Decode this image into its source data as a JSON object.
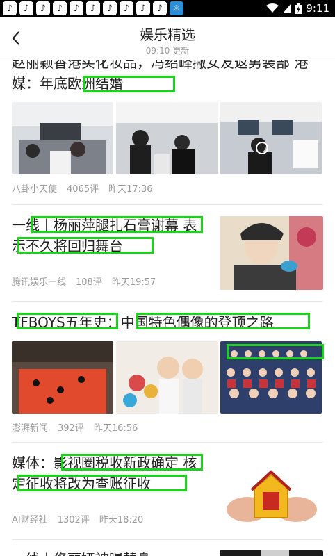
{
  "status_bar": {
    "time": "9:11",
    "notification_count": 11
  },
  "header": {
    "title": "娱乐精选",
    "updated": "09:10 更新"
  },
  "articles": [
    {
      "headline": "赵丽颖香港买化妆品，冯绍峰撇女友返男装部 港媒：年底欧洲结婚",
      "source": "八卦小天使",
      "comments": "4065评",
      "time": "昨天17:36",
      "image_style": "three"
    },
    {
      "headline": "一线丨杨丽萍腿扎石膏谢幕 表示不久将回归舞台",
      "source": "腾讯娱乐一线",
      "comments": "108评",
      "time": "昨天19:57",
      "image_style": "right"
    },
    {
      "headline": "TFBOYS五年史：中国特色偶像的登顶之路",
      "source": "澎湃新闻",
      "comments": "392评",
      "time": "昨天16:56",
      "image_style": "three"
    },
    {
      "headline": "媒体：影视圈税收新政确定 核定征收将改为查账征收",
      "source": "AI财经社",
      "comments": "1302评",
      "time": "昨天18:20",
      "image_style": "right"
    },
    {
      "headline": "一线丨佟丽娅被曝替身",
      "image_style": "right"
    }
  ],
  "colors": {
    "accent_highlight": "#18d518",
    "meta_text": "#999999"
  }
}
